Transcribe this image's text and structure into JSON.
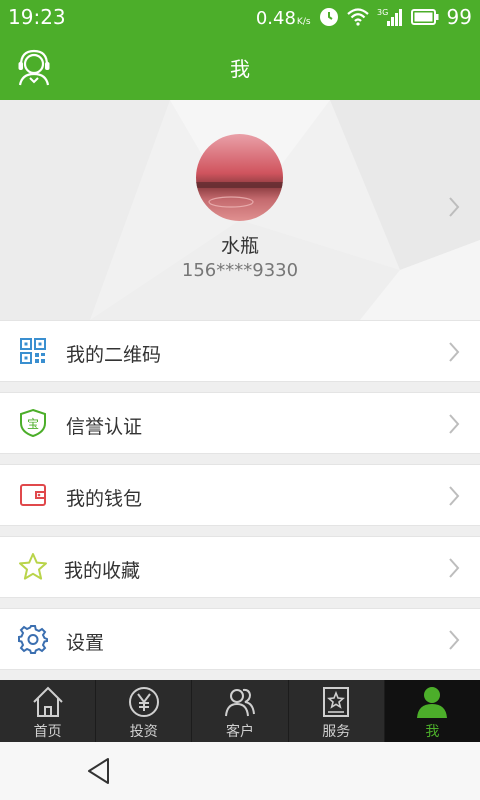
{
  "status_bar": {
    "time": "19:23",
    "net_speed": "0.48",
    "net_unit": "K/s",
    "signal": "3G",
    "battery": "99"
  },
  "header": {
    "title": "我",
    "left_icon": "customer-service-icon"
  },
  "profile": {
    "name": "水瓶",
    "phone": "156****9330"
  },
  "menu": [
    {
      "label": "我的二维码",
      "icon": "qr-code-icon"
    },
    {
      "label": "信誉认证",
      "icon": "shield-bao-icon"
    },
    {
      "label": "我的钱包",
      "icon": "wallet-icon"
    },
    {
      "label": "我的收藏",
      "icon": "star-icon"
    },
    {
      "label": "设置",
      "icon": "gear-icon"
    }
  ],
  "tabs": [
    {
      "label": "首页",
      "icon": "home-icon",
      "active": false
    },
    {
      "label": "投资",
      "icon": "yen-icon",
      "active": false
    },
    {
      "label": "客户",
      "icon": "people-icon",
      "active": false
    },
    {
      "label": "服务",
      "icon": "star-bookmark-icon",
      "active": false
    },
    {
      "label": "我",
      "icon": "person-icon",
      "active": true
    }
  ],
  "colors": {
    "brand_green": "#4cae2a",
    "tab_bg": "#2b2b2b"
  }
}
